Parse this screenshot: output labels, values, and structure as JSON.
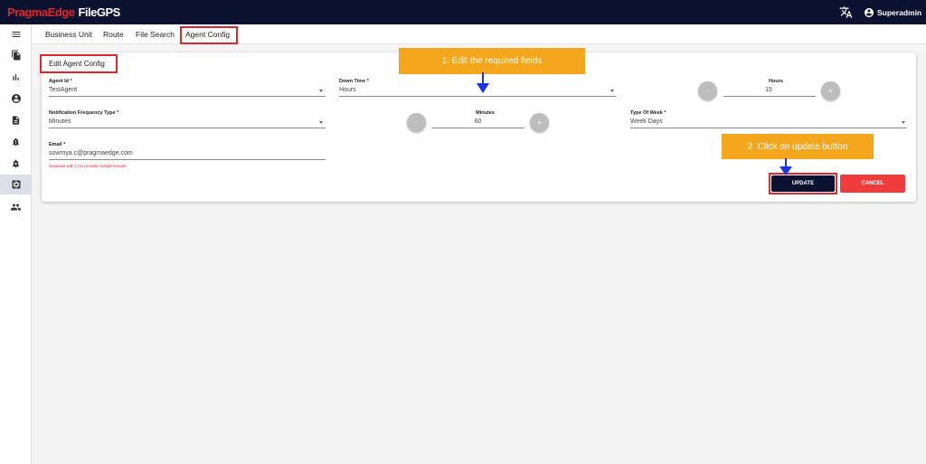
{
  "header": {
    "brand": "PragmaEdge",
    "product": "FileGPS",
    "user_name": "Superadmin",
    "translate_icon": "translate-icon",
    "user_icon": "account-circle-icon"
  },
  "sidebar": {
    "items": [
      {
        "icon": "menu-icon"
      },
      {
        "icon": "file-copy-icon"
      },
      {
        "icon": "bar-chart-icon"
      },
      {
        "icon": "account-circle-icon"
      },
      {
        "icon": "document-icon"
      },
      {
        "icon": "bell-alert-icon"
      },
      {
        "icon": "bell-settings-icon"
      },
      {
        "icon": "settings-box-icon",
        "active": true
      },
      {
        "icon": "group-icon"
      }
    ]
  },
  "tabs": [
    {
      "label": "Business Unit"
    },
    {
      "label": "Route"
    },
    {
      "label": "File Search"
    },
    {
      "label": "Agent Config",
      "active": true
    }
  ],
  "form": {
    "title": "Edit Agent Config",
    "agent_id": {
      "label": "Agent Id *",
      "value": "TestAgent"
    },
    "down_time": {
      "label": "Down Time *",
      "value": "Hours"
    },
    "hours": {
      "label": "Hours",
      "value": "15",
      "minus": "-",
      "plus": "+"
    },
    "notification_type": {
      "label": "Notification Frequency Type *",
      "value": "Minutes"
    },
    "minutes": {
      "label": "Minutes",
      "value": "60",
      "minus": "-",
      "plus": "+"
    },
    "type_of_week": {
      "label": "Type Of Week *",
      "value": "Week Days"
    },
    "email": {
      "label": "Email *",
      "value": "sowmya.c@pragmaedge.com",
      "helper": "Separate with (,) to provide multiple emails."
    },
    "update_label": "UPDATE",
    "cancel_label": "CANCEL"
  },
  "annotations": {
    "step1": "1. Edit the required fields",
    "step2": "2. Click on update button",
    "highlight_color": "#e0252b",
    "callout_color": "#f4a61d",
    "arrow_color": "#1a33e6"
  },
  "colors": {
    "topbar": "#0b1230",
    "brand_red": "#e0252b",
    "update_bg": "#0b1230",
    "cancel_bg": "#ef3b3b"
  }
}
